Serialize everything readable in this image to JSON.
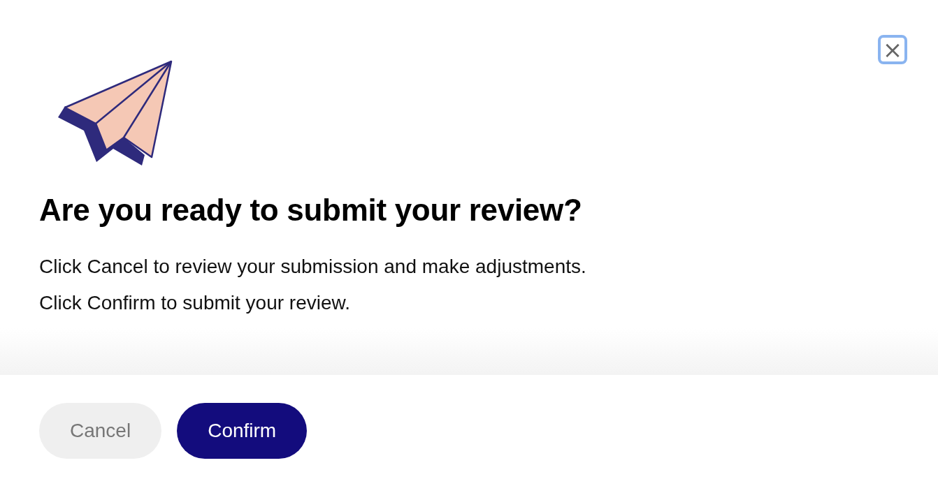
{
  "dialog": {
    "title": "Are you ready to submit your review?",
    "lines": [
      "Click Cancel to review your submission and make adjustments.",
      "Click Confirm to submit your review."
    ],
    "close": "×",
    "buttons": [
      {
        "label": "Cancel",
        "kind": "secondary"
      },
      {
        "label": "Confirm",
        "kind": "primary"
      }
    ]
  }
}
